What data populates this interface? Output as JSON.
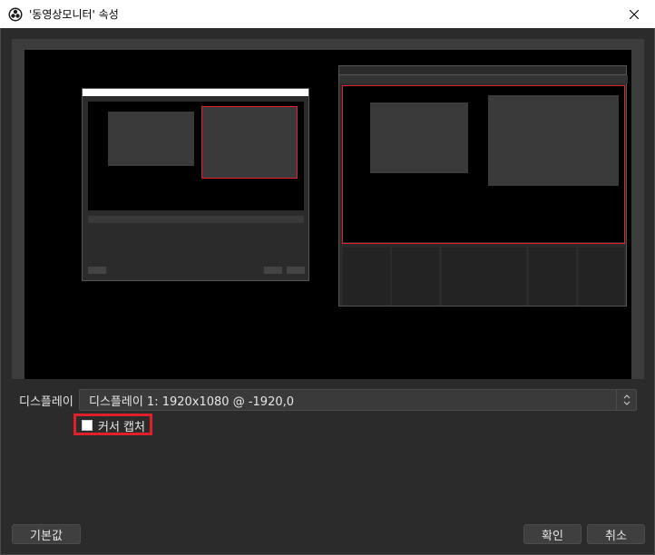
{
  "window": {
    "title": "'동영상모니터' 속성",
    "icon": "obs-icon"
  },
  "preview": {
    "description_icon": "monitor-preview"
  },
  "display": {
    "label": "디스플레이",
    "selected": "디스플레이 1: 1920x1080 @ -1920,0"
  },
  "cursor_capture": {
    "label": "커서 캡처",
    "checked": false
  },
  "buttons": {
    "defaults": "기본값",
    "ok": "확인",
    "cancel": "취소"
  },
  "colors": {
    "accent_red": "#e0202a",
    "background": "#2b2b2b"
  }
}
